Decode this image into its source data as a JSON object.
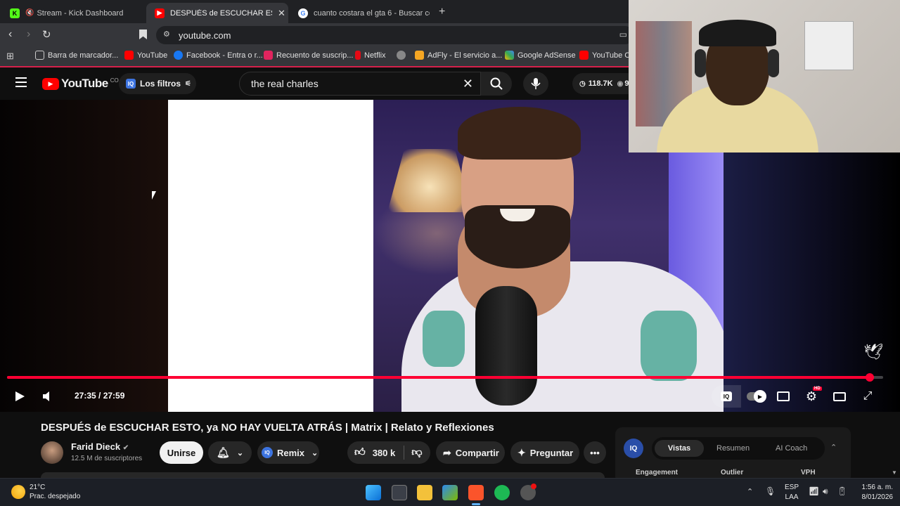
{
  "browser": {
    "tabs": [
      {
        "title": "Stream - Kick Dashboard",
        "active": false
      },
      {
        "title": "DESPUÉS de ESCUCHAR ESTO, ya",
        "active": true
      },
      {
        "title": "cuanto costara el gta 6 - Buscar con G",
        "active": false
      }
    ],
    "url": "youtube.com",
    "bookmarks": [
      "Barra de marcador...",
      "YouTube",
      "Facebook - Entra o r...",
      "Recuento de suscrip...",
      "Netflix",
      "AdFly - El servicio a...",
      "Google AdSense",
      "YouTube Cr"
    ]
  },
  "youtube": {
    "logo": "YouTube",
    "country": "CO",
    "filters_label": "Los filtros",
    "iq_badge": "IQ",
    "search_value": "the real charles",
    "views_count": "118.7K",
    "views_partial": "9"
  },
  "player": {
    "current_time": "27:35 / 27:59",
    "progress": 0.985,
    "hd_badge": "HD"
  },
  "video": {
    "title": "DESPUÉS de ESCUCHAR ESTO, ya NO HAY VUELTA ATRÁS | Matrix | Relato y Reflexiones",
    "channel": "Farid Dieck",
    "subscribers": "12.5 M de suscriptores",
    "join_label": "Unirse",
    "remix_label": "Remix",
    "likes": "380 k",
    "share_label": "Compartir",
    "ask_label": "Preguntar"
  },
  "side_panel": {
    "badge": "IQ",
    "tabs": [
      "Vistas",
      "Resumen",
      "AI Coach"
    ],
    "columns": [
      "Engagement",
      "Outlier",
      "VPH"
    ]
  },
  "taskbar": {
    "temperature": "21°C",
    "weather": "Prac. despejado",
    "lang1": "ESP",
    "lang2": "LAA",
    "time": "1:56 a. m.",
    "date": "8/01/2026"
  }
}
